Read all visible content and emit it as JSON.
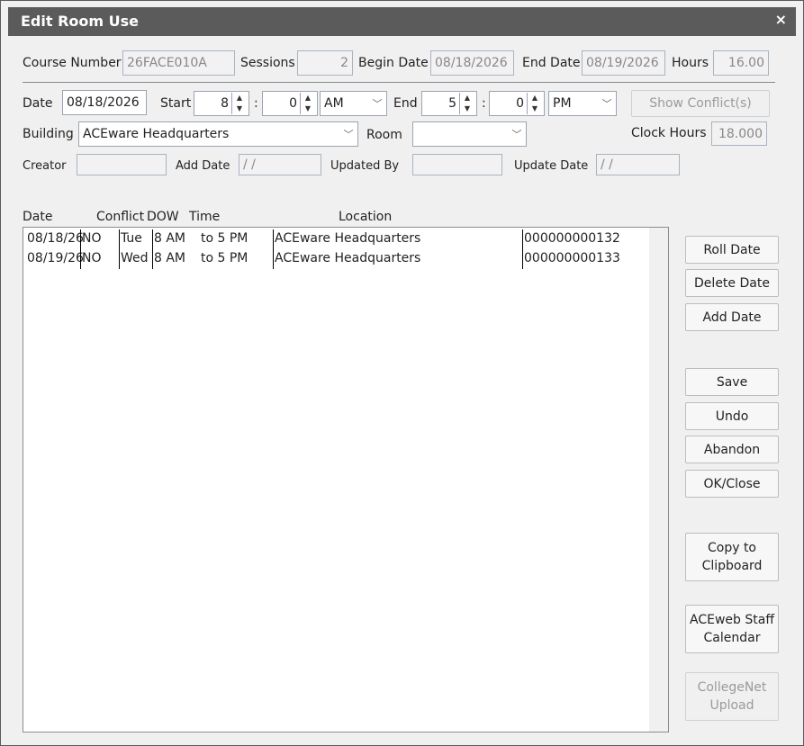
{
  "window": {
    "title": "Edit Room Use",
    "close_glyph": "×"
  },
  "header": {
    "course_number_label": "Course Number",
    "course_number_value": "26FACE010A",
    "sessions_label": "Sessions",
    "sessions_value": "2",
    "begin_date_label": "Begin Date",
    "begin_date_value": "08/18/2026",
    "end_date_label": "End Date",
    "end_date_value": "08/19/2026",
    "hours_label": "Hours",
    "hours_value": "16.00"
  },
  "edit": {
    "date_label": "Date",
    "date_value": "08/18/2026",
    "start_label": "Start",
    "start_hour": "8",
    "start_min": "0",
    "start_ampm": "AM",
    "colon": ":",
    "end_label": "End",
    "end_hour": "5",
    "end_min": "0",
    "end_ampm": "PM",
    "show_conflicts_label": "Show Conflict(s)",
    "building_label": "Building",
    "building_value": "ACEware Headquarters",
    "room_label": "Room",
    "room_value": "",
    "clock_hours_label": "Clock Hours",
    "clock_hours_value": "18.000",
    "creator_label": "Creator",
    "creator_value": "",
    "add_date_label": "Add Date",
    "add_date_value": " /  /",
    "updated_by_label": "Updated By",
    "updated_by_value": "",
    "update_date_label": "Update Date",
    "update_date_value": " /  /"
  },
  "grid": {
    "columns": [
      "Date",
      "Conflict",
      "DOW",
      "Time",
      "Location"
    ],
    "rows": [
      {
        "date": "08/18/26",
        "conflict": "NO",
        "dow": "Tue",
        "start": "8 AM",
        "end": "to 5 PM",
        "location": "ACEware Headquarters",
        "id": "000000000132"
      },
      {
        "date": "08/19/26",
        "conflict": "NO",
        "dow": "Wed",
        "start": "8 AM",
        "end": "to 5 PM",
        "location": "ACEware Headquarters",
        "id": "000000000133"
      }
    ]
  },
  "buttons": {
    "roll_date": "Roll Date",
    "delete_date": "Delete Date",
    "add_date": "Add Date",
    "save": "Save",
    "undo": "Undo",
    "abandon": "Abandon",
    "ok_close": "OK/Close",
    "copy_clipboard": "Copy to\nClipboard",
    "aceweb_calendar": "ACEweb Staff\nCalendar",
    "collegenet_upload": "CollegeNet\nUpload"
  }
}
